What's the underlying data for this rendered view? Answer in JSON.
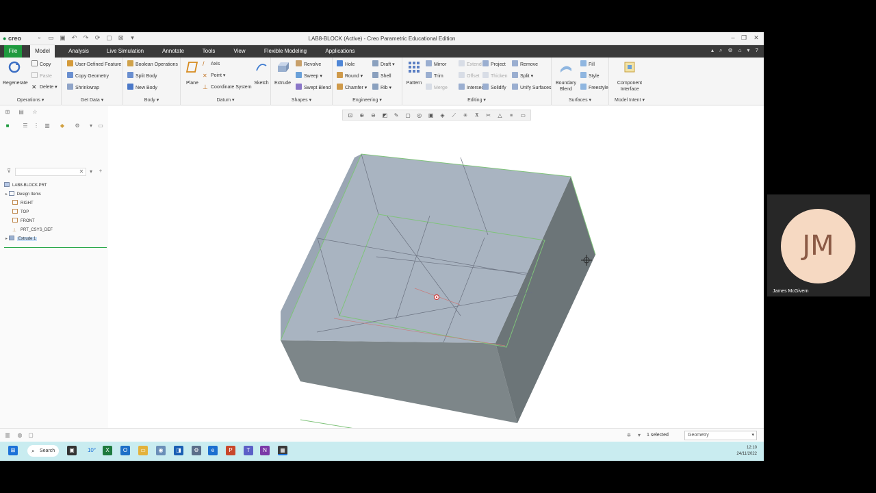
{
  "app": {
    "logo_text": "creo",
    "window_title": "LAB8-BLOCK (Active) - Creo Parametric Educational Edition"
  },
  "tabs": [
    "File",
    "Model",
    "Analysis",
    "Live Simulation",
    "Annotate",
    "Tools",
    "View",
    "Flexible Modeling",
    "Applications"
  ],
  "ribbon": {
    "operations": {
      "regenerate": "Regenerate",
      "copy": "Copy",
      "paste": "Paste",
      "delete": "Delete",
      "label": "Operations"
    },
    "get_data": {
      "udf": "User-Defined Feature",
      "copy_geometry": "Copy Geometry",
      "shrinkwrap": "Shrinkwrap",
      "label": "Get Data"
    },
    "body": {
      "boolean": "Boolean Operations",
      "split_body": "Split Body",
      "new_body": "New Body",
      "label": "Body"
    },
    "datum": {
      "plane": "Plane",
      "axis": "Axis",
      "point": "Point",
      "csys": "Coordinate System",
      "label": "Datum"
    },
    "shapes": {
      "sketch": "Sketch",
      "extrude": "Extrude",
      "revolve": "Revolve",
      "sweep": "Sweep",
      "swept_blend": "Swept Blend",
      "label": "Shapes"
    },
    "engineering": {
      "hole": "Hole",
      "round": "Round",
      "chamfer": "Chamfer",
      "draft": "Draft",
      "shell": "Shell",
      "rib": "Rib",
      "label": "Engineering"
    },
    "editing": {
      "pattern": "Pattern",
      "mirror": "Mirror",
      "trim": "Trim",
      "merge": "Merge",
      "extend": "Extend",
      "offset": "Offset",
      "intersect": "Intersect",
      "thicken": "Thicken",
      "solidify": "Solidify",
      "project": "Project",
      "remove": "Remove",
      "split": "Split",
      "unify": "Unify Surfaces",
      "label": "Editing"
    },
    "surfaces": {
      "boundary_blend": "Boundary Blend",
      "fill": "Fill",
      "style": "Style",
      "freestyle": "Freestyle",
      "label": "Surfaces"
    },
    "model_intent": {
      "component_interface": "Component Interface",
      "label": "Model Intent"
    }
  },
  "tree": {
    "filter_placeholder": "",
    "items": [
      "LAB8-BLOCK.PRT",
      "Design Items",
      "RIGHT",
      "TOP",
      "FRONT",
      "PRT_CSYS_DEF",
      "Extrude 1"
    ]
  },
  "status": {
    "selected": "1 selected",
    "filter_value": "Geometry"
  },
  "taskbar": {
    "search": "Search",
    "weather": "10°",
    "time": "12:10",
    "date": "24/11/2022"
  },
  "video": {
    "initials": "JM",
    "name": "James McGivern"
  },
  "colors": {
    "accent_green": "#1e9a3e",
    "top_face": "#a9b5c2",
    "right_face": "#6c7577",
    "front_face": "#7c8587"
  }
}
